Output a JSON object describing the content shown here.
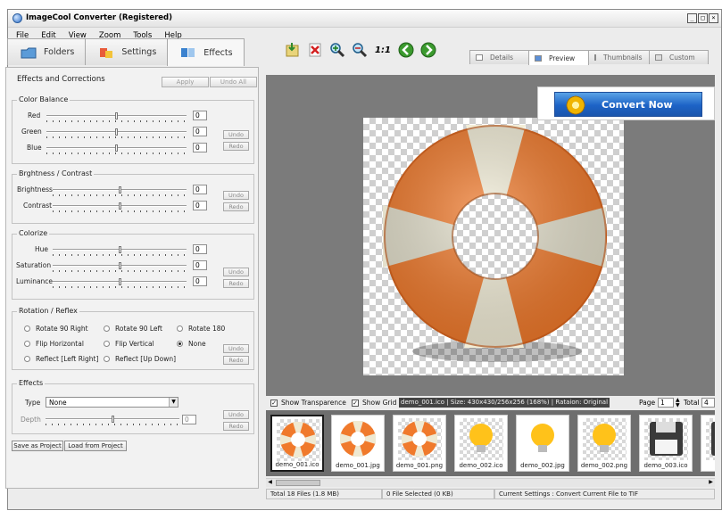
{
  "window": {
    "title": "ImageCool Converter  (Registered)",
    "buttons": [
      "_",
      "□",
      "×"
    ]
  },
  "menu": [
    "File",
    "Edit",
    "View",
    "Zoom",
    "Tools",
    "Help"
  ],
  "left_tabs": [
    {
      "label": "Folders"
    },
    {
      "label": "Settings"
    },
    {
      "label": "Effects"
    }
  ],
  "toolbar": {
    "zoom_1_1": "1:1"
  },
  "right_tabs": [
    {
      "label": "Details"
    },
    {
      "label": "Preview"
    },
    {
      "label": "Thumbnails"
    },
    {
      "label": "Custom"
    }
  ],
  "effects": {
    "title": "Effects and Corrections",
    "apply": "Apply",
    "undo_all": "Undo All",
    "color_balance": {
      "title": "Color Balance",
      "red": "Red",
      "green": "Green",
      "blue": "Blue",
      "red_val": "0",
      "green_val": "0",
      "blue_val": "0"
    },
    "brightness": {
      "title": "Brghtness / Contrast",
      "brightness": "Brightness",
      "contrast": "Contrast",
      "brightness_val": "0",
      "contrast_val": "0"
    },
    "colorize": {
      "title": "Colorize",
      "hue": "Hue",
      "saturation": "Saturation",
      "luminance": "Luminance",
      "hue_val": "0",
      "saturation_val": "0",
      "luminance_val": "0"
    },
    "rotation": {
      "title": "Rotation / Reflex",
      "options": [
        "Rotate 90 Right",
        "Rotate 90 Left",
        "Rotate 180",
        "Flip Horizontal",
        "Flip Vertical",
        "None",
        "Reflect [Left Right]",
        "Reflect [Up Down]"
      ],
      "selected": "None"
    },
    "fx": {
      "title": "Effects",
      "type_label": "Type",
      "type_value": "None",
      "depth_label": "Depth",
      "depth_val": "0"
    },
    "undo": "Undo",
    "redo": "Redo",
    "save_project": "Save as Project",
    "load_project": "Load from Project"
  },
  "convert": {
    "label": "Convert Now"
  },
  "preview": {
    "show_transparence": "Show Transparence",
    "show_grid": "Show Grid",
    "info": "demo_001.ico | Size: 430x430/256x256 (168%) | Rataion: Original",
    "page_label": "Page",
    "page_val": "1",
    "total_label": "Total",
    "total_val": "4"
  },
  "thumbnails": [
    "demo_001.ico",
    "demo_001.jpg",
    "demo_001.png",
    "demo_002.ico",
    "demo_002.jpg",
    "demo_002.png",
    "demo_003.ico",
    "dem"
  ],
  "status": {
    "total": "Total 18 Files (1.8 MB)",
    "selected": "0 File Selected (0 KB)",
    "settings": "Current Settings : Convert Current File to TIF"
  },
  "colors": {
    "accent": "#1d63c6",
    "orange": "#f07a2c"
  }
}
